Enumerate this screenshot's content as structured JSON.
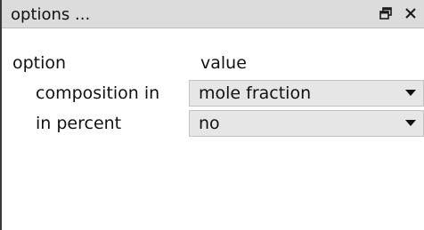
{
  "panel": {
    "title": "options ...",
    "float_icon": "restore-window-icon",
    "close_icon": "close-icon"
  },
  "table": {
    "headers": {
      "option": "option",
      "value": "value"
    },
    "rows": [
      {
        "option": "composition in",
        "value": "mole fraction",
        "control": "dropdown"
      },
      {
        "option": "in percent",
        "value": "no",
        "control": "dropdown"
      }
    ]
  },
  "colors": {
    "titlebar_bg": "#dcdcdc",
    "combo_bg": "#e6e6e6",
    "text": "#111111"
  }
}
